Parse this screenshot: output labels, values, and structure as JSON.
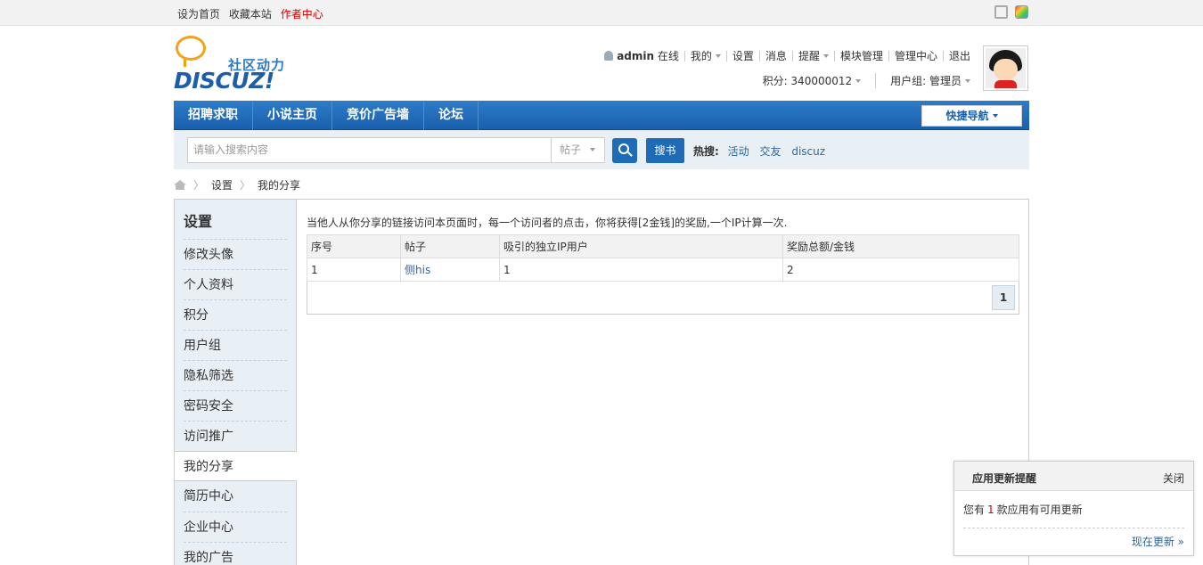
{
  "topbar": {
    "set_home": "设为首页",
    "bookmark": "收藏本站",
    "author_center": "作者中心"
  },
  "logo": {
    "cn": "社区动力",
    "en": "DISCUZ!"
  },
  "user": {
    "name": "admin",
    "status": "在线",
    "menu_mine": "我的",
    "settings": "设置",
    "messages": "消息",
    "reminders": "提醒",
    "module_manage": "模块管理",
    "admin_center": "管理中心",
    "logout": "退出",
    "points": "积分: 340000012",
    "usergroup": "用户组: 管理员"
  },
  "nav": {
    "items": [
      "招聘求职",
      "小说主页",
      "竞价广告墙",
      "论坛"
    ],
    "quick_nav": "快捷导航"
  },
  "search": {
    "placeholder": "请输入搜索内容",
    "type": "帖子",
    "book_button": "搜书",
    "hot_label": "热搜:",
    "hot_terms": [
      "活动",
      "交友",
      "discuz"
    ]
  },
  "breadcrumb": {
    "settings": "设置",
    "current": "我的分享"
  },
  "sidebar": {
    "title": "设置",
    "items": [
      "修改头像",
      "个人资料",
      "积分",
      "用户组",
      "隐私筛选",
      "密码安全",
      "访问推广",
      "我的分享",
      "简历中心",
      "企业中心",
      "我的广告"
    ]
  },
  "content": {
    "intro": "当他人从你分享的链接访问本页面时，每一个访问者的点击，你将获得[2金钱]的奖励,一个IP计算一次.",
    "columns": [
      "序号",
      "帖子",
      "吸引的独立IP用户",
      "奖励总额/金钱"
    ],
    "rows": [
      {
        "no": "1",
        "post": "侧his",
        "ips": "1",
        "reward": "2"
      }
    ],
    "page": "1"
  },
  "popup": {
    "title": "应用更新提醒",
    "close": "关闭",
    "text_pre": "您有",
    "count": "1",
    "text_post": "款应用有可用更新",
    "update_now": "现在更新 »"
  }
}
